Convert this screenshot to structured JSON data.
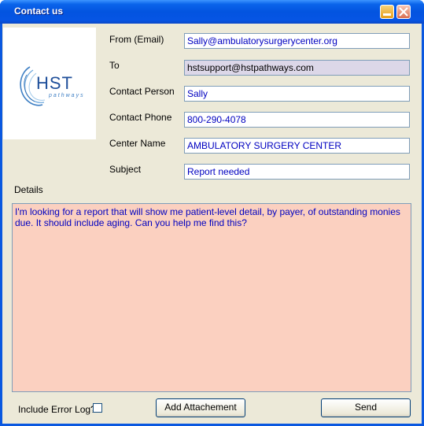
{
  "window": {
    "title": "Contact us"
  },
  "logo": {
    "text": "HST",
    "subtext": "pathways"
  },
  "form": {
    "from_label": "From  (Email)",
    "from_value": "Sally@ambulatorysurgerycenter.org",
    "to_label": "To",
    "to_value": "hstsupport@hstpathways.com",
    "contact_person_label": "Contact Person",
    "contact_person_value": "Sally",
    "contact_phone_label": "Contact Phone",
    "contact_phone_value": "800-290-4078",
    "center_name_label": "Center Name",
    "center_name_value": "AMBULATORY SURGERY CENTER",
    "subject_label": "Subject",
    "subject_value": "Report needed",
    "details_label": "Details",
    "details_value": "I'm looking for a report that will show me patient-level detail, by payer, of outstanding monies due.  It should include aging.  Can you help me find this?"
  },
  "footer": {
    "include_error_log_label": "Include Error Log?",
    "include_error_log_checked": false,
    "add_attachment_label": "Add Attachement",
    "send_label": "Send"
  },
  "colors": {
    "title_bar": "#0354e0",
    "details_background": "#fbd0c0",
    "readonly_field": "#dcd7e8",
    "field_text": "#0000c0"
  }
}
